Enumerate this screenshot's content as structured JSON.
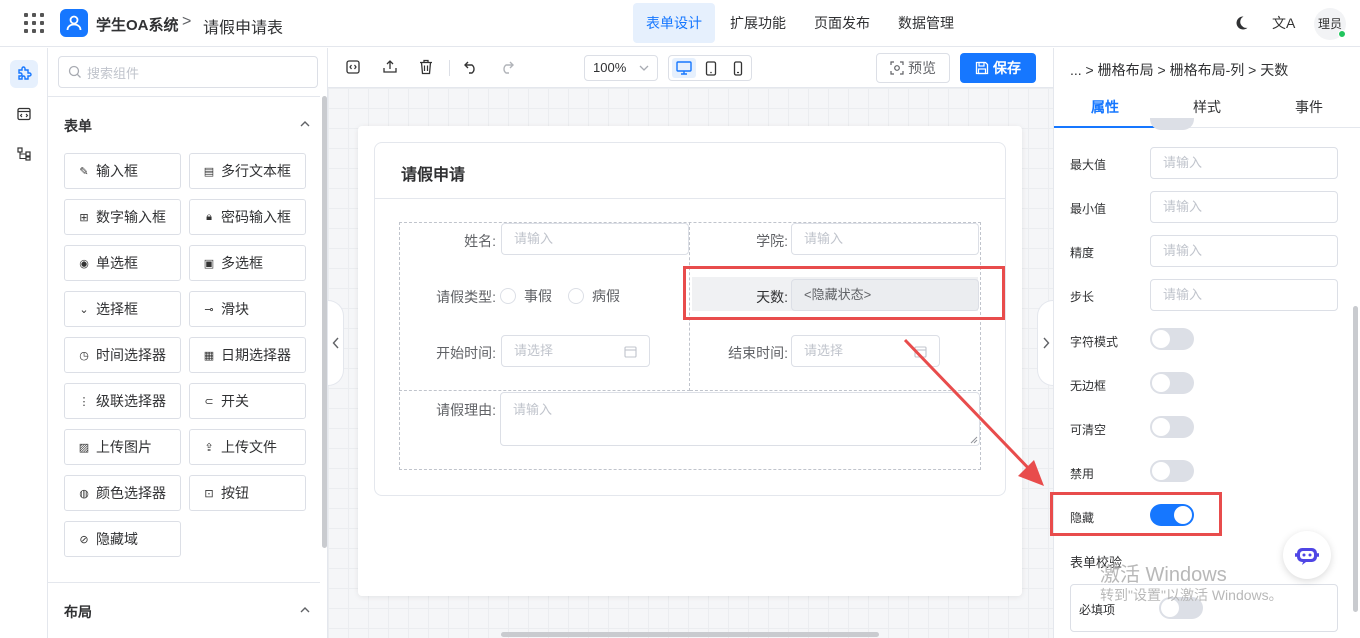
{
  "header": {
    "app_title": "学生OA系统",
    "breadcrumb_sep": ">",
    "page_title": "请假申请表",
    "nav": [
      {
        "label": "表单设计",
        "active": true
      },
      {
        "label": "扩展功能",
        "active": false
      },
      {
        "label": "页面发布",
        "active": false
      },
      {
        "label": "数据管理",
        "active": false
      }
    ],
    "translate_icon": "文A",
    "avatar_text": "理员",
    "accent_color": "#1677ff"
  },
  "sidebar": {
    "rail_icons": [
      "puzzle-icon",
      "code-window-icon",
      "flow-icon"
    ],
    "search_placeholder": "搜索组件",
    "section_form": "表单",
    "section_layout": "布局",
    "components": [
      {
        "label": "输入框",
        "icon": "pencil-icon"
      },
      {
        "label": "多行文本框",
        "icon": "textarea-icon"
      },
      {
        "label": "数字输入框",
        "icon": "number-icon"
      },
      {
        "label": "密码输入框",
        "icon": "lock-icon"
      },
      {
        "label": "单选框",
        "icon": "radio-icon"
      },
      {
        "label": "多选框",
        "icon": "checkbox-icon"
      },
      {
        "label": "选择框",
        "icon": "select-icon"
      },
      {
        "label": "滑块",
        "icon": "slider-icon"
      },
      {
        "label": "时间选择器",
        "icon": "clock-icon"
      },
      {
        "label": "日期选择器",
        "icon": "calendar-icon"
      },
      {
        "label": "级联选择器",
        "icon": "cascader-icon"
      },
      {
        "label": "开关",
        "icon": "switch-icon"
      },
      {
        "label": "上传图片",
        "icon": "image-icon"
      },
      {
        "label": "上传文件",
        "icon": "upload-icon"
      },
      {
        "label": "颜色选择器",
        "icon": "palette-icon"
      },
      {
        "label": "按钮",
        "icon": "button-icon"
      },
      {
        "label": "隐藏域",
        "icon": "eye-off-icon"
      }
    ]
  },
  "toolbar": {
    "zoom": "100%",
    "preview_label": "预览",
    "save_label": "保存"
  },
  "form": {
    "title": "请假申请",
    "fields": {
      "name_label": "姓名:",
      "name_placeholder": "请输入",
      "college_label": "学院:",
      "college_placeholder": "请输入",
      "leave_type_label": "请假类型:",
      "leave_type_options": [
        "事假",
        "病假"
      ],
      "days_label": "天数:",
      "days_hidden_text": "<隐藏状态>",
      "start_label": "开始时间:",
      "start_placeholder": "请选择",
      "end_label": "结束时间:",
      "end_placeholder": "请选择",
      "reason_label": "请假理由:",
      "reason_placeholder": "请输入"
    }
  },
  "properties": {
    "breadcrumb": "... > 栅格布局 > 栅格布局-列 > 天数",
    "tabs": [
      {
        "label": "属性",
        "active": true
      },
      {
        "label": "样式",
        "active": false
      },
      {
        "label": "事件",
        "active": false
      }
    ],
    "inputs": [
      {
        "label": "最大值",
        "placeholder": "请输入"
      },
      {
        "label": "最小值",
        "placeholder": "请输入"
      },
      {
        "label": "精度",
        "placeholder": "请输入"
      },
      {
        "label": "步长",
        "placeholder": "请输入"
      }
    ],
    "switches": [
      {
        "label": "字符模式",
        "on": false
      },
      {
        "label": "无边框",
        "on": false
      },
      {
        "label": "可清空",
        "on": false
      },
      {
        "label": "禁用",
        "on": false
      },
      {
        "label": "隐藏",
        "on": true
      }
    ],
    "validation_label": "表单校验",
    "required_label": "必填项",
    "required_on": false
  },
  "watermark": {
    "line1": "激活 Windows",
    "line2": "转到\"设置\"以激活 Windows。"
  },
  "annotation_color": "#e84c4c"
}
